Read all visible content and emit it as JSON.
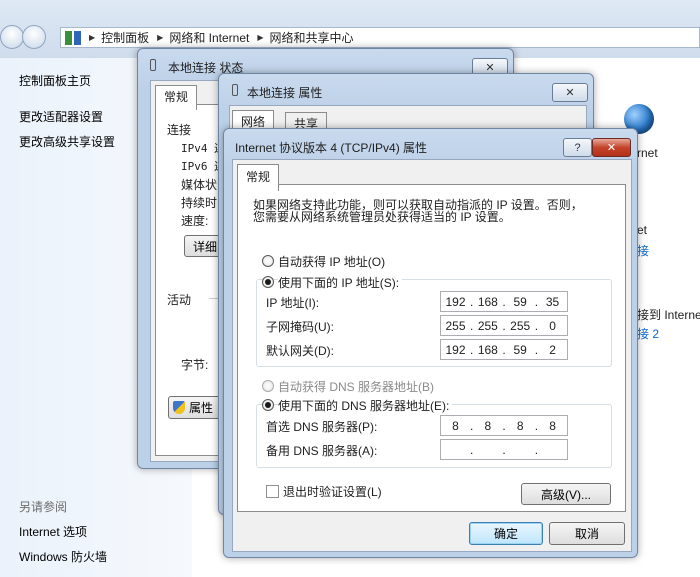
{
  "address_bar": {
    "crumbs": [
      "控制面板",
      "网络和 Internet",
      "网络和共享中心"
    ]
  },
  "left_pane": {
    "links": [
      "控制面板主页",
      "更改适配器设置",
      "更改高级共享设置"
    ],
    "see_also_heading": "另请参阅",
    "see_also_links": [
      "Internet 选项",
      "Windows 防火墙"
    ]
  },
  "right_behind": {
    "globe_label": "rnet",
    "item1": "et",
    "item2": "接",
    "item3": "接到 Interne",
    "item4": "接 2"
  },
  "status_window": {
    "title": "本地连接 状态",
    "close": "✕",
    "tab": "常规",
    "connection_label": "连接",
    "rows": [
      "IPv4 连",
      "IPv6 连",
      "媒体状",
      "持续时",
      "速度:"
    ],
    "details_button": "详细",
    "activity_label": "活动",
    "bytes_label": "字节:",
    "properties_button": "属性"
  },
  "props_window": {
    "title": "本地连接 属性",
    "close": "✕",
    "tabs": [
      "网络",
      "共享"
    ]
  },
  "ipv4_dialog": {
    "title": "Internet 协议版本 4 (TCP/IPv4) 属性",
    "help": "?",
    "close": "✕",
    "tab": "常规",
    "description_line1": "如果网络支持此功能，则可以获取自动指派的 IP 设置。否则，",
    "description_line2": "您需要从网络系统管理员处获得适当的 IP 设置。",
    "auto_ip_label": "自动获得 IP 地址(O)",
    "manual_ip_label": "使用下面的 IP 地址(S):",
    "ip_label": "IP 地址(I):",
    "ip_value": [
      "192",
      "168",
      "59",
      "35"
    ],
    "mask_label": "子网掩码(U):",
    "mask_value": [
      "255",
      "255",
      "255",
      "0"
    ],
    "gateway_label": "默认网关(D):",
    "gateway_value": [
      "192",
      "168",
      "59",
      "2"
    ],
    "auto_dns_label": "自动获得 DNS 服务器地址(B)",
    "manual_dns_label": "使用下面的 DNS 服务器地址(E):",
    "preferred_dns_label": "首选 DNS 服务器(P):",
    "preferred_dns_value": [
      "8",
      "8",
      "8",
      "8"
    ],
    "alternate_dns_label": "备用 DNS 服务器(A):",
    "alternate_dns_value": [
      "",
      "",
      "",
      ""
    ],
    "validate_label": "退出时验证设置(L)",
    "advanced_button": "高级(V)...",
    "ok_button": "确定",
    "cancel_button": "取消"
  }
}
